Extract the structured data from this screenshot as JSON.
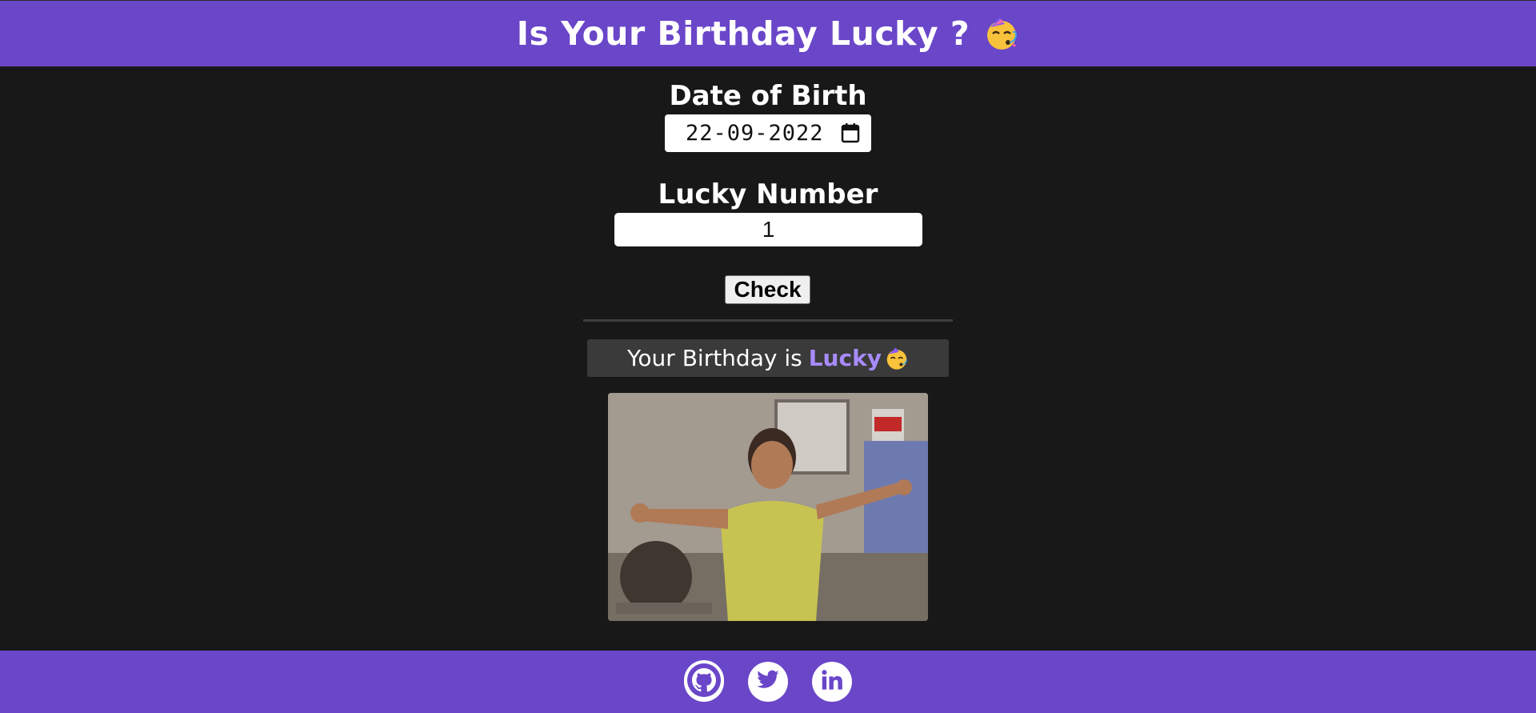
{
  "header": {
    "title": "Is Your Birthday Lucky ?",
    "emoji": "partying-face-icon"
  },
  "form": {
    "dob_label": "Date of Birth",
    "dob_value": "22-09-2022",
    "lucky_label": "Lucky Number",
    "lucky_value": "1",
    "check_label": "Check"
  },
  "result": {
    "prefix": "Your Birthday is",
    "highlight": "Lucky",
    "emoji": "partying-face-icon"
  },
  "footer": {
    "links": [
      "github-icon",
      "twitter-icon",
      "linkedin-icon"
    ]
  },
  "colors": {
    "brand": "#6a46c9",
    "background": "#181818",
    "highlight": "#a88bff"
  }
}
